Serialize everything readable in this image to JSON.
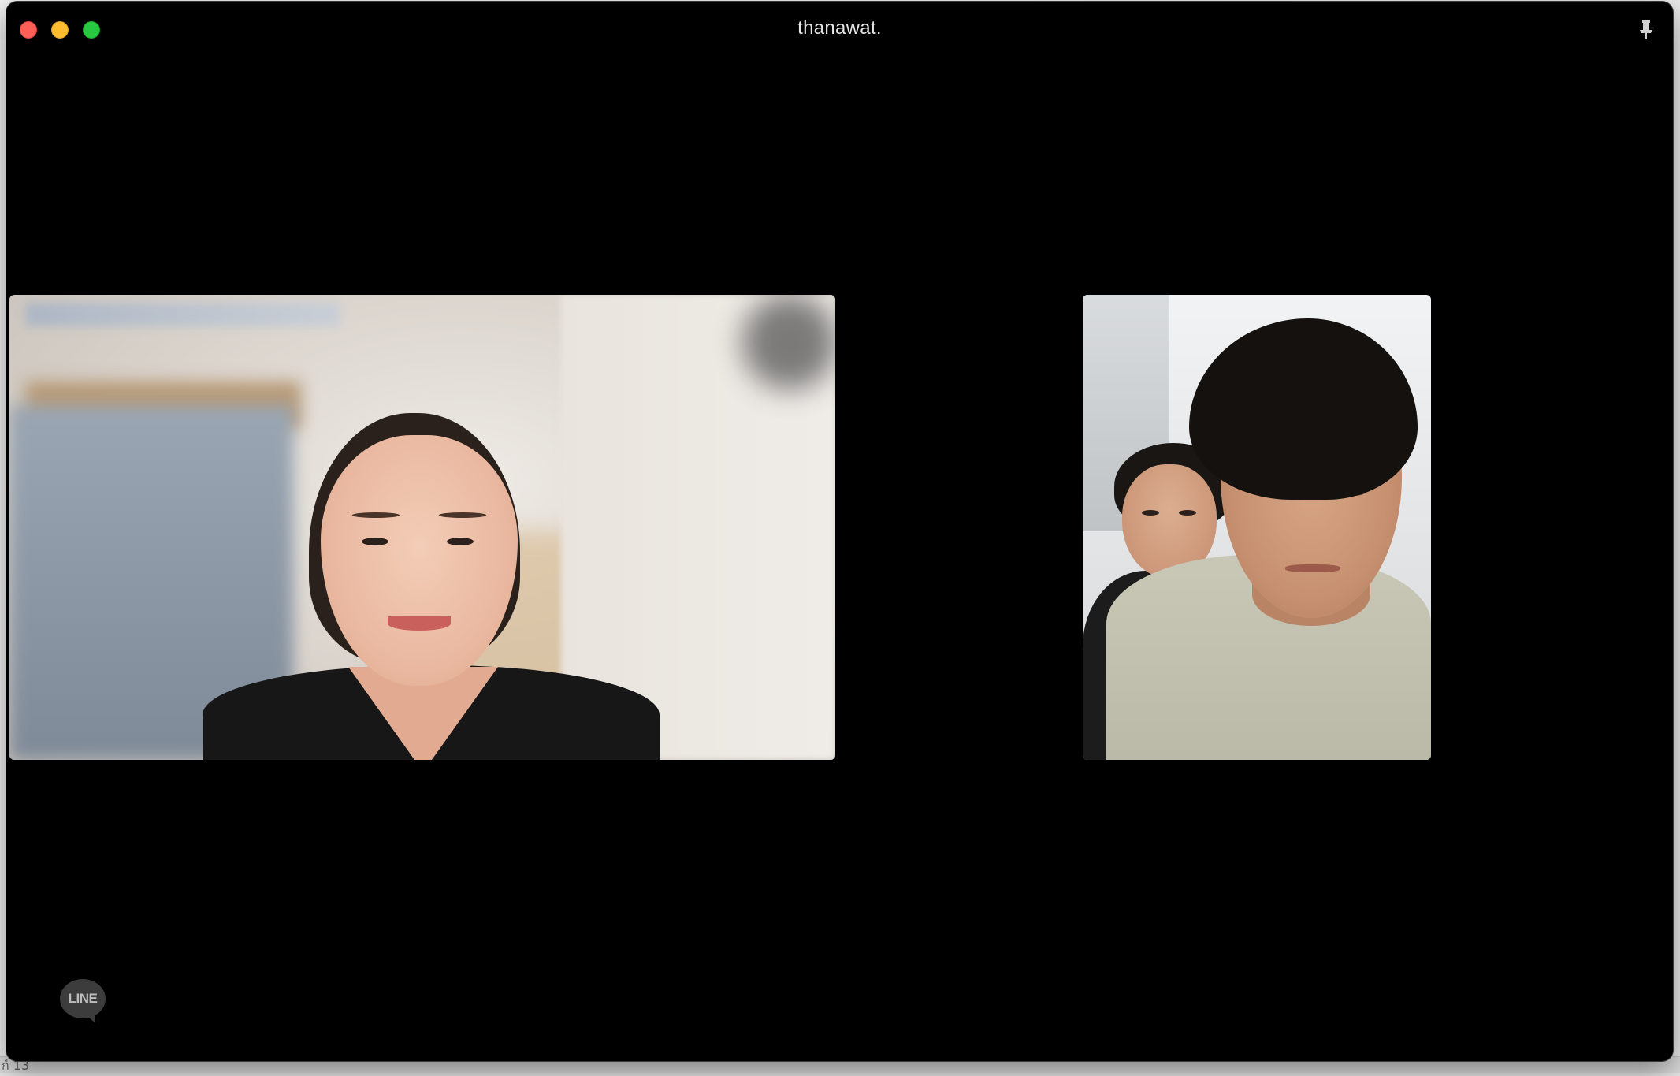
{
  "window": {
    "title": "thanawat."
  },
  "controls": {
    "close_color": "#fe5f57",
    "minimize_color": "#febc2e",
    "maximize_color": "#28c840",
    "pin_icon": "pin-icon"
  },
  "videos": [
    {
      "id": "remote-participant-video",
      "content": "woman smiling, black top, blurred office background"
    },
    {
      "id": "local-participant-video",
      "content": "two young men, light tee in front"
    }
  ],
  "branding": {
    "logo_text": "LINE"
  },
  "background_app": {
    "bottom_text": "ก์ 13"
  }
}
